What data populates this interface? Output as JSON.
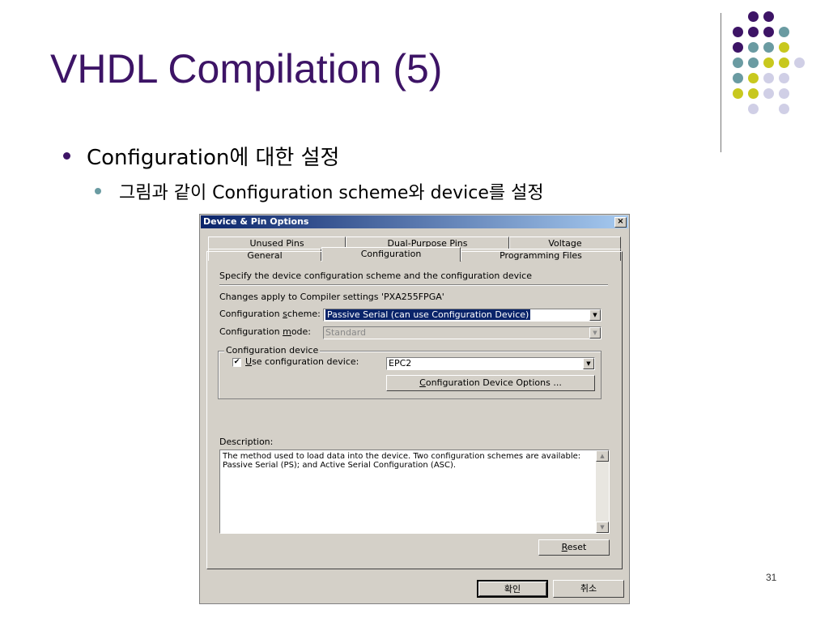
{
  "slide": {
    "title": "VHDL Compilation (5)",
    "bullet1": "Configuration에 대한 설정",
    "bullet2": "그림과 같이 Configuration scheme와 device를 설정",
    "page_number": "31"
  },
  "colors": {
    "title": "#3d1466",
    "dot_purple": "#3d1466",
    "dot_teal": "#6a9ba2",
    "dot_yellow": "#c8c81e",
    "dot_lavender": "#d0cfe6"
  },
  "dialog": {
    "title": "Device & Pin Options",
    "close_glyph": "×",
    "tabs_back": [
      "Unused Pins",
      "Dual-Purpose Pins",
      "Voltage"
    ],
    "tabs_front": [
      "General",
      "Configuration",
      "Programming Files"
    ],
    "active_tab": "Configuration",
    "intro": "Specify the device configuration scheme and the configuration device",
    "changes_note": "Changes apply to Compiler settings 'PXA255FPGA'",
    "scheme_label_pre": "Configuration ",
    "scheme_label_key": "s",
    "scheme_label_post": "cheme:",
    "scheme_value": "Passive Serial (can use Configuration Device)",
    "mode_label_pre": "Configuration ",
    "mode_label_key": "m",
    "mode_label_post": "ode:",
    "mode_value": "Standard",
    "group_label": "Configuration device",
    "use_device_check": "✔",
    "use_device_key": "U",
    "use_device_label": "se configuration device:",
    "device_value": "EPC2",
    "device_options_key": "C",
    "device_options_button": "onfiguration Device Options ...",
    "description_label": "Description:",
    "description_text": "The method used to load data into the device. Two configuration schemes are available: Passive Serial (PS); and Active Serial Configuration (ASC).",
    "reset_key": "R",
    "reset_button": "eset",
    "ok_button": "확인",
    "cancel_button": "취소",
    "arrow_glyph": "▼",
    "scroll_up_glyph": "▲",
    "scroll_down_glyph": "▼"
  }
}
